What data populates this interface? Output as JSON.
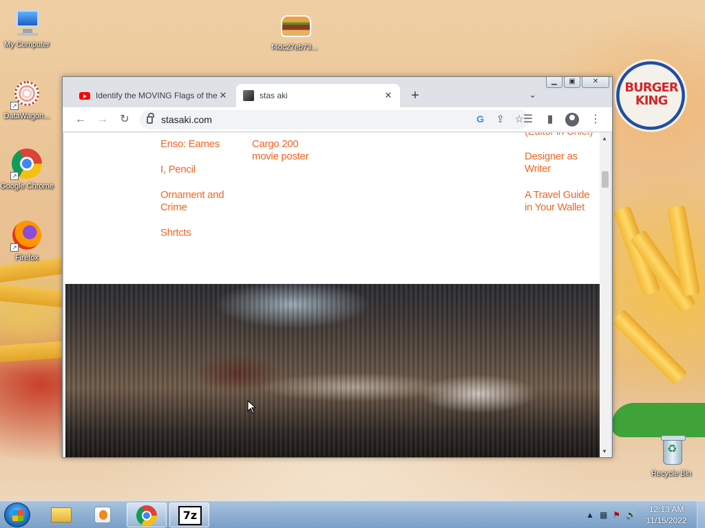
{
  "desktop": {
    "icons": [
      {
        "label": "My Computer"
      },
      {
        "label": "f4dc27eb73..."
      },
      {
        "label": "DataWagon..."
      },
      {
        "label": "Google Chrome"
      },
      {
        "label": "Firefox"
      },
      {
        "label": "Recycle Bin"
      }
    ],
    "wallpaper_text": "BURGER KING"
  },
  "browser": {
    "tabs": [
      {
        "title": "Identify the MOVING Flags of the",
        "favicon": "youtube-icon",
        "active": false
      },
      {
        "title": "stas aki",
        "favicon": "profile-photo-icon",
        "active": true
      }
    ],
    "address": "stasaki.com",
    "page": {
      "col1": [
        "Enso: Eames",
        "I, Pencil",
        "Ornament and Crime",
        "Shrtcts"
      ],
      "col2": [
        "Cargo 200 movie poster"
      ],
      "col3_partial": "(Editor in Chief)",
      "col3": [
        "Designer as Writer",
        "A Travel Guide in Your Wallet"
      ],
      "link_color": "#f26522"
    }
  },
  "taskbar": {
    "clock_time": "12:13 AM",
    "clock_date": "11/15/2022",
    "accent": "#8fb0d3"
  }
}
